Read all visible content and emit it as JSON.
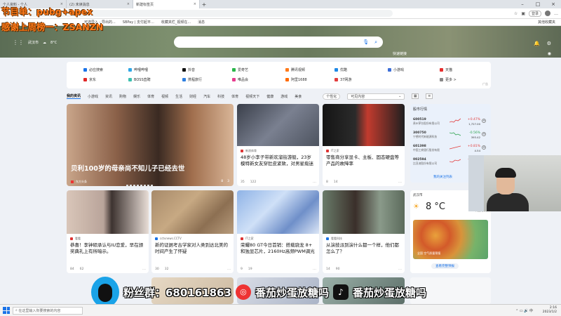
{
  "browser": {
    "tabs": [
      {
        "label": "个人资料 - 个人"
      },
      {
        "label": "(2) 未读消息"
      },
      {
        "label": "新建标签页"
      }
    ],
    "new_tab": "+",
    "url": "",
    "login_label": "登录",
    "favorites": [
      "可选导入 - 导出的...",
      "SBPay | 支付起平...",
      "收藏夹栏_视频在...",
      "消息"
    ],
    "other_favorites": "其他收藏夹"
  },
  "hero": {
    "location": "武汉市",
    "temp": "8°C",
    "quick_links_label": "快速链接"
  },
  "quick_links": [
    {
      "label": "必应搜索",
      "color": "#1a73e8"
    },
    {
      "label": "哔哩哔哩",
      "color": "#2fa7e6"
    },
    {
      "label": "抖音",
      "color": "#111"
    },
    {
      "label": "爱奇艺",
      "color": "#2ab54a"
    },
    {
      "label": "腾讯视频",
      "color": "#ff7a1a"
    },
    {
      "label": "优酷",
      "color": "#1e88e5"
    },
    {
      "label": "小游戏",
      "color": "#3d6fd8"
    },
    {
      "label": "天猫",
      "color": "#e62e2e"
    },
    {
      "label": "京东",
      "color": "#e12727"
    },
    {
      "label": "BOSS直聘",
      "color": "#3cc0b0"
    },
    {
      "label": "携程旅行",
      "color": "#2e7fe0"
    },
    {
      "label": "唯品会",
      "color": "#e63c8f"
    },
    {
      "label": "阿里1688",
      "color": "#ff6a00"
    },
    {
      "label": "37网游",
      "color": "#e23d3d"
    },
    {
      "label": "更多 >",
      "color": "#888"
    }
  ],
  "quick_links_ad": "广告",
  "feed_tabs": [
    "我的资讯",
    "小游戏",
    "资讯",
    "购物",
    "娱乐",
    "体育",
    "视频",
    "生活",
    "财经",
    "汽车",
    "科技",
    "体育",
    "视频天下",
    "健康",
    "游戏",
    "美食",
    "旅游"
  ],
  "personalize": "个性化",
  "feed_select": "可见内容",
  "cards": {
    "big": {
      "title": "贝利100岁的母亲尚不知儿子已经去世",
      "source": "东方头条",
      "likes": "8",
      "comments": "3"
    },
    "c1": {
      "source": "新浪体育",
      "title": "48岁小李子带新欢溜街游艇，23岁模特新女友穿肚皮紧致，对男星痴迷",
      "likes": "35",
      "comments": "122"
    },
    "c2": {
      "source": "IT之家",
      "title": "零售商分享显卡、主板、固态硬盘等产品的故障率",
      "likes": "8",
      "comments": "14"
    },
    "c3": {
      "source": "看看",
      "title": "恭喜！李钟硕承认与IU恋爱，早在颁奖典礼上有所暗示。",
      "likes": "84",
      "comments": "62"
    },
    "c4": {
      "source": "cctvnews.CCTV",
      "title": "新的证据考古学家对人类到达北美的时间产生了怀疑",
      "likes": "30",
      "comments": "32"
    },
    "c5": {
      "source": "IT之家",
      "title": "荣耀80 GT今日首销：搭载骁龙 8+ 和独显芯片，2160Hz高频PWM调光",
      "likes": "9",
      "comments": "19"
    },
    "c6": {
      "source": "看看科技",
      "title": "从演技派到演什么都一个样，他们都怎么了？",
      "likes": "14",
      "comments": "90"
    }
  },
  "stocks": {
    "title": "股市行情",
    "rows": [
      {
        "code": "600519",
        "name": "贵州茅台股份有限公司",
        "change": "+0.47%",
        "price": "1,727.00"
      },
      {
        "code": "300750",
        "name": "宁德时代新能源科技",
        "change": "-0.56%",
        "price": "393.42"
      },
      {
        "code": "601398",
        "name": "中国工商银行股份有限",
        "change": "+0.81%",
        "price": "4.54"
      },
      {
        "code": "002594",
        "name": "比亚迪股份有限公司",
        "change": "+0.55%",
        "price": "268.77"
      }
    ],
    "watch_button": "我的关注列表"
  },
  "weather": {
    "location": "武汉市",
    "temp": "8 °C",
    "forecast": "中度污染",
    "map_label": "全国 空气质量预报",
    "button": "查看完整预报"
  },
  "overlay": {
    "line1": "节目单：pubg+apex",
    "line2": "感谢上周榜一：ZSANZN",
    "fans": "粉丝群：680161863",
    "weibo": "番茄炒蛋放糖吗",
    "douyin": "番茄炒蛋放糖吗"
  },
  "taskbar": {
    "search": "在这里输入你要搜索的内容",
    "time": "2:16",
    "date": "2023/1/2"
  }
}
